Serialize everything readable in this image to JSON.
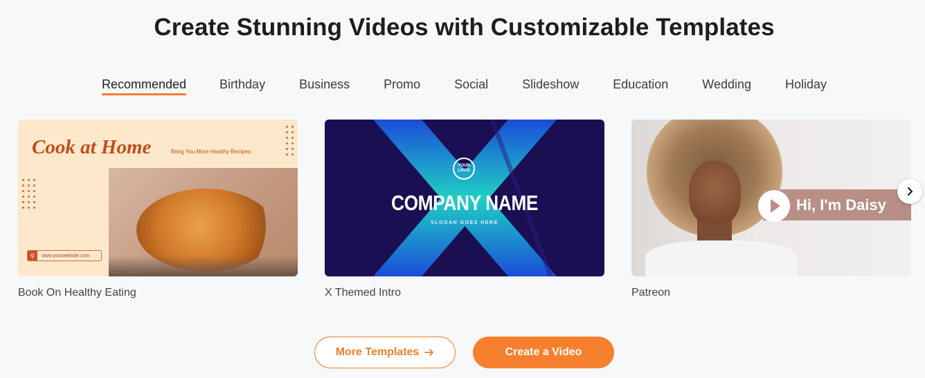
{
  "title": "Create Stunning Videos with Customizable Templates",
  "tabs": [
    {
      "label": "Recommended",
      "active": true
    },
    {
      "label": "Birthday"
    },
    {
      "label": "Business"
    },
    {
      "label": "Promo"
    },
    {
      "label": "Social"
    },
    {
      "label": "Slideshow"
    },
    {
      "label": "Education"
    },
    {
      "label": "Wedding"
    },
    {
      "label": "Holiday"
    }
  ],
  "templates": [
    {
      "caption": "Book On Healthy Eating",
      "heading": "Cook at Home",
      "subheading": "Bring You More Healthy Recipes",
      "url": "www.yourwebsite.com"
    },
    {
      "caption": "X Themed Intro",
      "logo": "YOUR LOGO",
      "company": "COMPANY NAME",
      "slogan": "SLOGAN GOES HERE"
    },
    {
      "caption": "Patreon",
      "banner": "Hi, I'm Daisy"
    }
  ],
  "buttons": {
    "more": "More Templates",
    "create": "Create a Video"
  },
  "colors": {
    "accent": "#f07f2a",
    "background": "#f7f8fa"
  },
  "icons": {
    "next": "chevron-right-icon",
    "arrow": "arrow-right-icon"
  }
}
